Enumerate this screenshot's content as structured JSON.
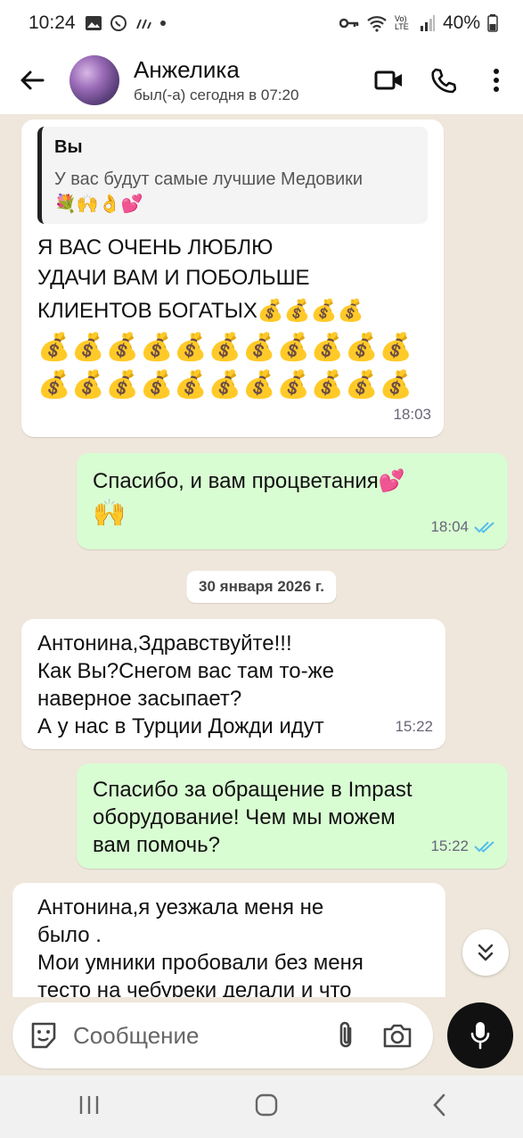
{
  "status_bar": {
    "time": "10:24",
    "battery": "40%",
    "volte": "Vo) LTE"
  },
  "header": {
    "contact_name": "Анжелика",
    "last_seen": "был(-а) сегодня в 07:20"
  },
  "messages": [
    {
      "direction": "incoming",
      "quote_author": "Вы",
      "quote_text": "У вас будут  самые лучшие Медовики",
      "quote_emoji": "💐🙌👌💕",
      "lines": [
        "Я ВАС ОЧЕНЬ ЛЮБЛЮ",
        "УДАЧИ ВАМ И ПОБОЛЬШЕ",
        "КЛИЕНТОВ БОГАТЫХ💰💰💰💰"
      ],
      "bag_lines": [
        "💰💰💰💰💰💰💰💰💰💰💰",
        "💰💰💰💰💰💰💰💰💰💰💰"
      ],
      "time": "18:03"
    },
    {
      "direction": "outgoing",
      "lines": [
        "Спасибо,  и вам  процветания💕",
        "🙌"
      ],
      "time": "18:04",
      "read": true
    },
    {
      "direction": "date",
      "label": "30 января 2026 г."
    },
    {
      "direction": "incoming",
      "lines": [
        "Антонина,Здравствуйте!!!",
        "Как Вы?Снегом вас там то-же",
        "наверное  засыпает?",
        "А у нас в Турции Дожди идут"
      ],
      "time": "15:22"
    },
    {
      "direction": "outgoing",
      "lines": [
        "Спасибо за обращение в Impast",
        "оборудование! Чем мы можем",
        "вам помочь?"
      ],
      "time": "15:22",
      "read": true
    },
    {
      "direction": "incoming",
      "lines": [
        "Антонина,я уезжала меня не",
        "было .",
        "Мои умники пробовали без меня",
        "тесто на чебуреки  делали и что"
      ]
    }
  ],
  "input": {
    "placeholder": "Сообщение"
  },
  "colors": {
    "incoming_bubble": "#ffffff",
    "outgoing_bubble": "#d9fdd3",
    "read_ticks": "#53bdeb",
    "chat_bg": "#efe7dc"
  }
}
